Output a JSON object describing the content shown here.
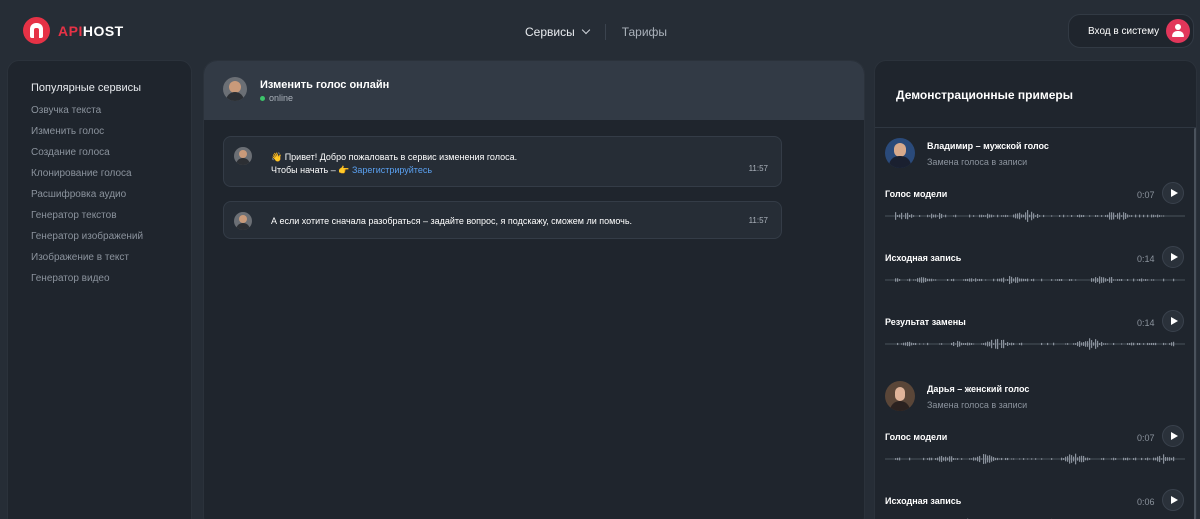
{
  "header": {
    "logo": {
      "part1": "API",
      "part2": "HOST"
    },
    "nav": {
      "services": "Сервисы",
      "tariffs": "Тарифы"
    },
    "login_label": "Вход в систему"
  },
  "sidebar": {
    "title": "Популярные сервисы",
    "items": [
      "Озвучка текста",
      "Изменить голос",
      "Создание голоса",
      "Клонирование голоса",
      "Расшифровка аудио",
      "Генератор текстов",
      "Генератор изображений",
      "Изображение в текст",
      "Генератор видео"
    ]
  },
  "chat": {
    "title": "Изменить голос онлайн",
    "status": "online",
    "messages": [
      {
        "line1": "👋 Привет! Добро пожаловать в сервис изменения голоса.",
        "line2_prefix": "Чтобы начать – 👉 ",
        "link": "Зарегистрируйтесь",
        "time": "11:57"
      },
      {
        "line1": "А если хотите сначала разобраться – задайте вопрос, я подскажу, сможем ли помочь.",
        "time": "11:57"
      }
    ]
  },
  "demo": {
    "title": "Демонстрационные примеры",
    "people": [
      {
        "name": "Владимир – мужской голос",
        "subtitle": "Замена голоса в записи",
        "tracks": [
          {
            "label": "Голос модели",
            "time": "0:07"
          },
          {
            "label": "Исходная запись",
            "time": "0:14"
          },
          {
            "label": "Результат замены",
            "time": "0:14"
          }
        ]
      },
      {
        "name": "Дарья – женский голос",
        "subtitle": "Замена голоса в записи",
        "tracks": [
          {
            "label": "Голос модели",
            "time": "0:07"
          },
          {
            "label": "Исходная запись",
            "time": "0:06"
          }
        ]
      }
    ]
  },
  "colors": {
    "accent": "#e63246",
    "link": "#5aa0f0",
    "online": "#3cc46a"
  },
  "icons": [
    "logo-icon",
    "chevron-down-icon",
    "user-icon",
    "bot-avatar",
    "play-icon"
  ]
}
